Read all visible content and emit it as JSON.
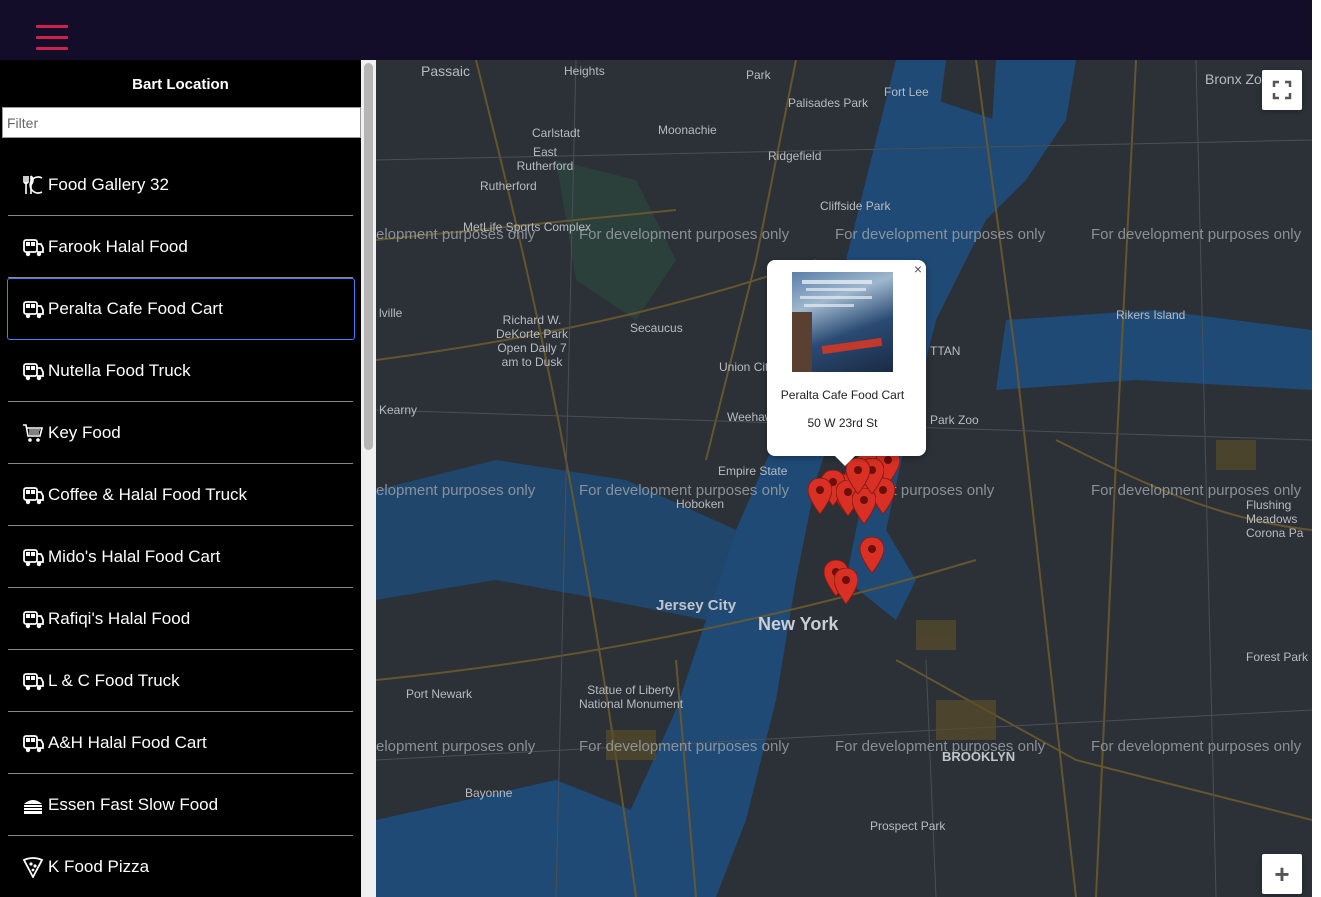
{
  "header": {
    "menu_icon": "hamburger-menu-icon",
    "accent_color": "#d0204c"
  },
  "sidebar": {
    "title": "Bart Location",
    "filter_placeholder": "Filter",
    "items": [
      {
        "label": "Food Gallery 32",
        "icon": "restaurant-icon"
      },
      {
        "label": "Farook Halal Food",
        "icon": "food-truck-icon"
      },
      {
        "label": "Peralta Cafe Food Cart",
        "icon": "food-truck-icon",
        "selected": true
      },
      {
        "label": "Nutella Food Truck",
        "icon": "food-truck-icon"
      },
      {
        "label": "Key Food",
        "icon": "shopping-cart-icon"
      },
      {
        "label": "Coffee & Halal Food Truck",
        "icon": "food-truck-icon"
      },
      {
        "label": "Mido's Halal Food Cart",
        "icon": "food-truck-icon"
      },
      {
        "label": "Rafiqi's Halal Food",
        "icon": "food-truck-icon"
      },
      {
        "label": "L & C Food Truck",
        "icon": "food-truck-icon"
      },
      {
        "label": "A&H Halal Food Cart",
        "icon": "food-truck-icon"
      },
      {
        "label": "Essen Fast Slow Food",
        "icon": "cake-icon"
      },
      {
        "label": "K Food Pizza",
        "icon": "pizza-icon"
      }
    ]
  },
  "map": {
    "watermark": "For development purposes only",
    "watermark_partial": "elopment purposes only",
    "labels": {
      "passaic": "Passaic",
      "heights": "Heights",
      "park": "Park",
      "fort_lee": "Fort Lee",
      "palisades_park": "Palisades Park",
      "bronx_zoo": "Bronx Zoo",
      "moonachie": "Moonachie",
      "carlstadt": "Carlstadt",
      "east_rutherford": "East Rutherford",
      "rutherford": "Rutherford",
      "ridgefield": "Ridgefield",
      "cliffside_park": "Cliffside Park",
      "metlife": "MetLife Sports Complex",
      "richard": "Richard W. DeKorte Park Open Daily 7 am to Dusk",
      "secaucus": "Secaucus",
      "union_city": "Union City",
      "weehawken": "Weehawken",
      "kearny": "Kearny",
      "lyndhurst": "lville",
      "empire_state": "Empire State",
      "hoboken": "Hoboken",
      "rikers": "Rikers Island",
      "park_zoo": "Park Zoo",
      "jersey_city": "Jersey City",
      "new_york": "New York",
      "port_newark": "Port Newark",
      "statue": "Statue of Liberty National Monument",
      "bayonne": "Bayonne",
      "prospect_park": "Prospect Park",
      "brooklyn": "BROOKLYN",
      "forest_park": "Forest Park",
      "flushing": "Flushing Meadows Corona Pa",
      "ttan": "TTAN"
    },
    "popup": {
      "name": "Peralta Cafe Food Cart",
      "address": "50 W 23rd St",
      "close": "×"
    },
    "controls": {
      "fullscreen_icon": "fullscreen-icon",
      "zoom_in": "+"
    },
    "marker_color": "#d93025"
  }
}
